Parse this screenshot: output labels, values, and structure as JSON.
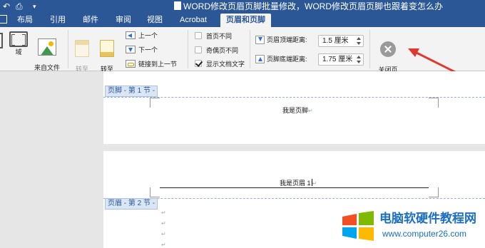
{
  "window": {
    "title": "WORD修改页眉页脚批量修改，WORD修改页眉页脚也跟着变怎么办"
  },
  "tabs": [
    {
      "label": "布局"
    },
    {
      "label": "引用"
    },
    {
      "label": "邮件"
    },
    {
      "label": "审阅"
    },
    {
      "label": "视图"
    },
    {
      "label": "Acrobat"
    },
    {
      "label": "页眉和页脚",
      "active": true
    }
  ],
  "ribbon": {
    "field_label": "域",
    "picture_from_file_label": "来自文件\n的图片",
    "goto_header_label": "转至\n页眉",
    "goto_footer_label": "转至\n页脚",
    "previous_label": "上一个",
    "next_label": "下一个",
    "link_to_previous_label": "链接到上一节",
    "options": [
      {
        "label": "首页不同",
        "checked": false
      },
      {
        "label": "奇偶页不同",
        "checked": false
      },
      {
        "label": "显示文档文字",
        "checked": true
      }
    ],
    "header_from_top_label": "页眉顶端距离:",
    "header_from_top_value": "1.5 厘米",
    "footer_from_bottom_label": "页脚底端距离:",
    "footer_from_bottom_value": "1.75 厘米",
    "close_label": "关闭页\n眉和页脚"
  },
  "document": {
    "footer_section_label": "页脚 - 第 1 节 -",
    "footer_text": "我是页脚",
    "header_text": "我是页眉 1",
    "header_section_label": "页眉 - 第 2 节 -"
  },
  "watermark": {
    "title": "电脑软硬件教程网",
    "url": "www.computer26.com"
  },
  "colors": {
    "ribbon_blue": "#2b5797",
    "section_label_bg": "#dbe6f5",
    "arrow_red": "#e03a2f"
  }
}
